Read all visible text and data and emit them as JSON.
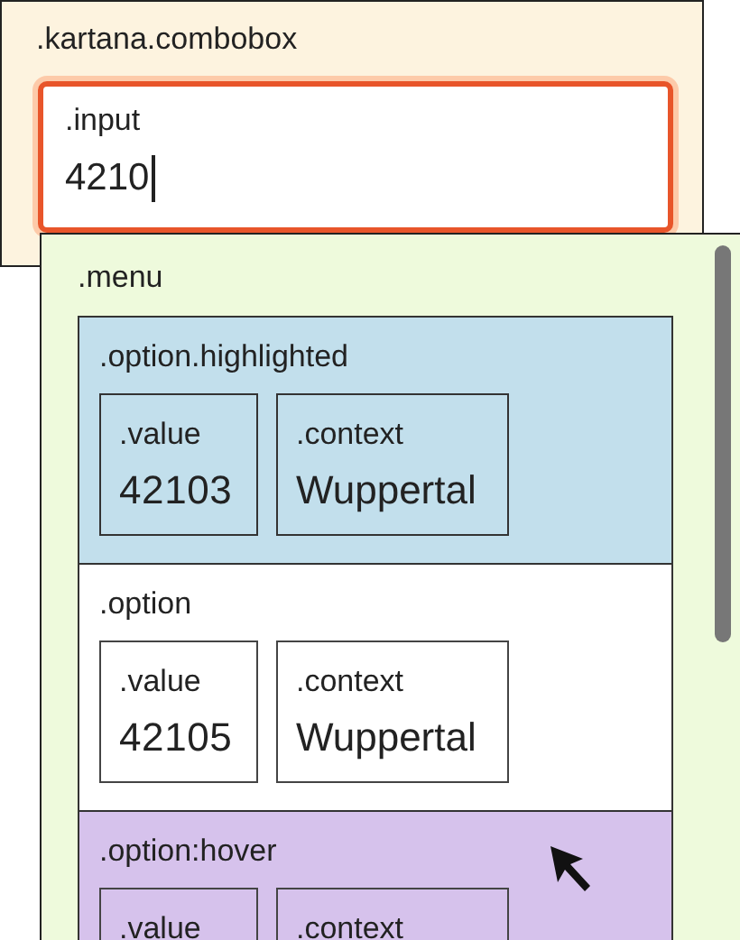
{
  "combobox": {
    "label": ".kartana.combobox",
    "input": {
      "label": ".input",
      "value": "4210",
      "focused": true
    },
    "menu": {
      "label": ".menu",
      "options": [
        {
          "label": ".option.highlighted",
          "highlighted": true,
          "hovered": false,
          "value_label": ".value",
          "value": "42103",
          "context_label": ".context",
          "context": "Wuppertal"
        },
        {
          "label": ".option",
          "highlighted": false,
          "hovered": false,
          "value_label": ".value",
          "value": "42105",
          "context_label": ".context",
          "context": "Wuppertal"
        },
        {
          "label": ".option:hover",
          "highlighted": false,
          "hovered": true,
          "value_label": ".value",
          "context_label": ".context"
        }
      ]
    }
  }
}
